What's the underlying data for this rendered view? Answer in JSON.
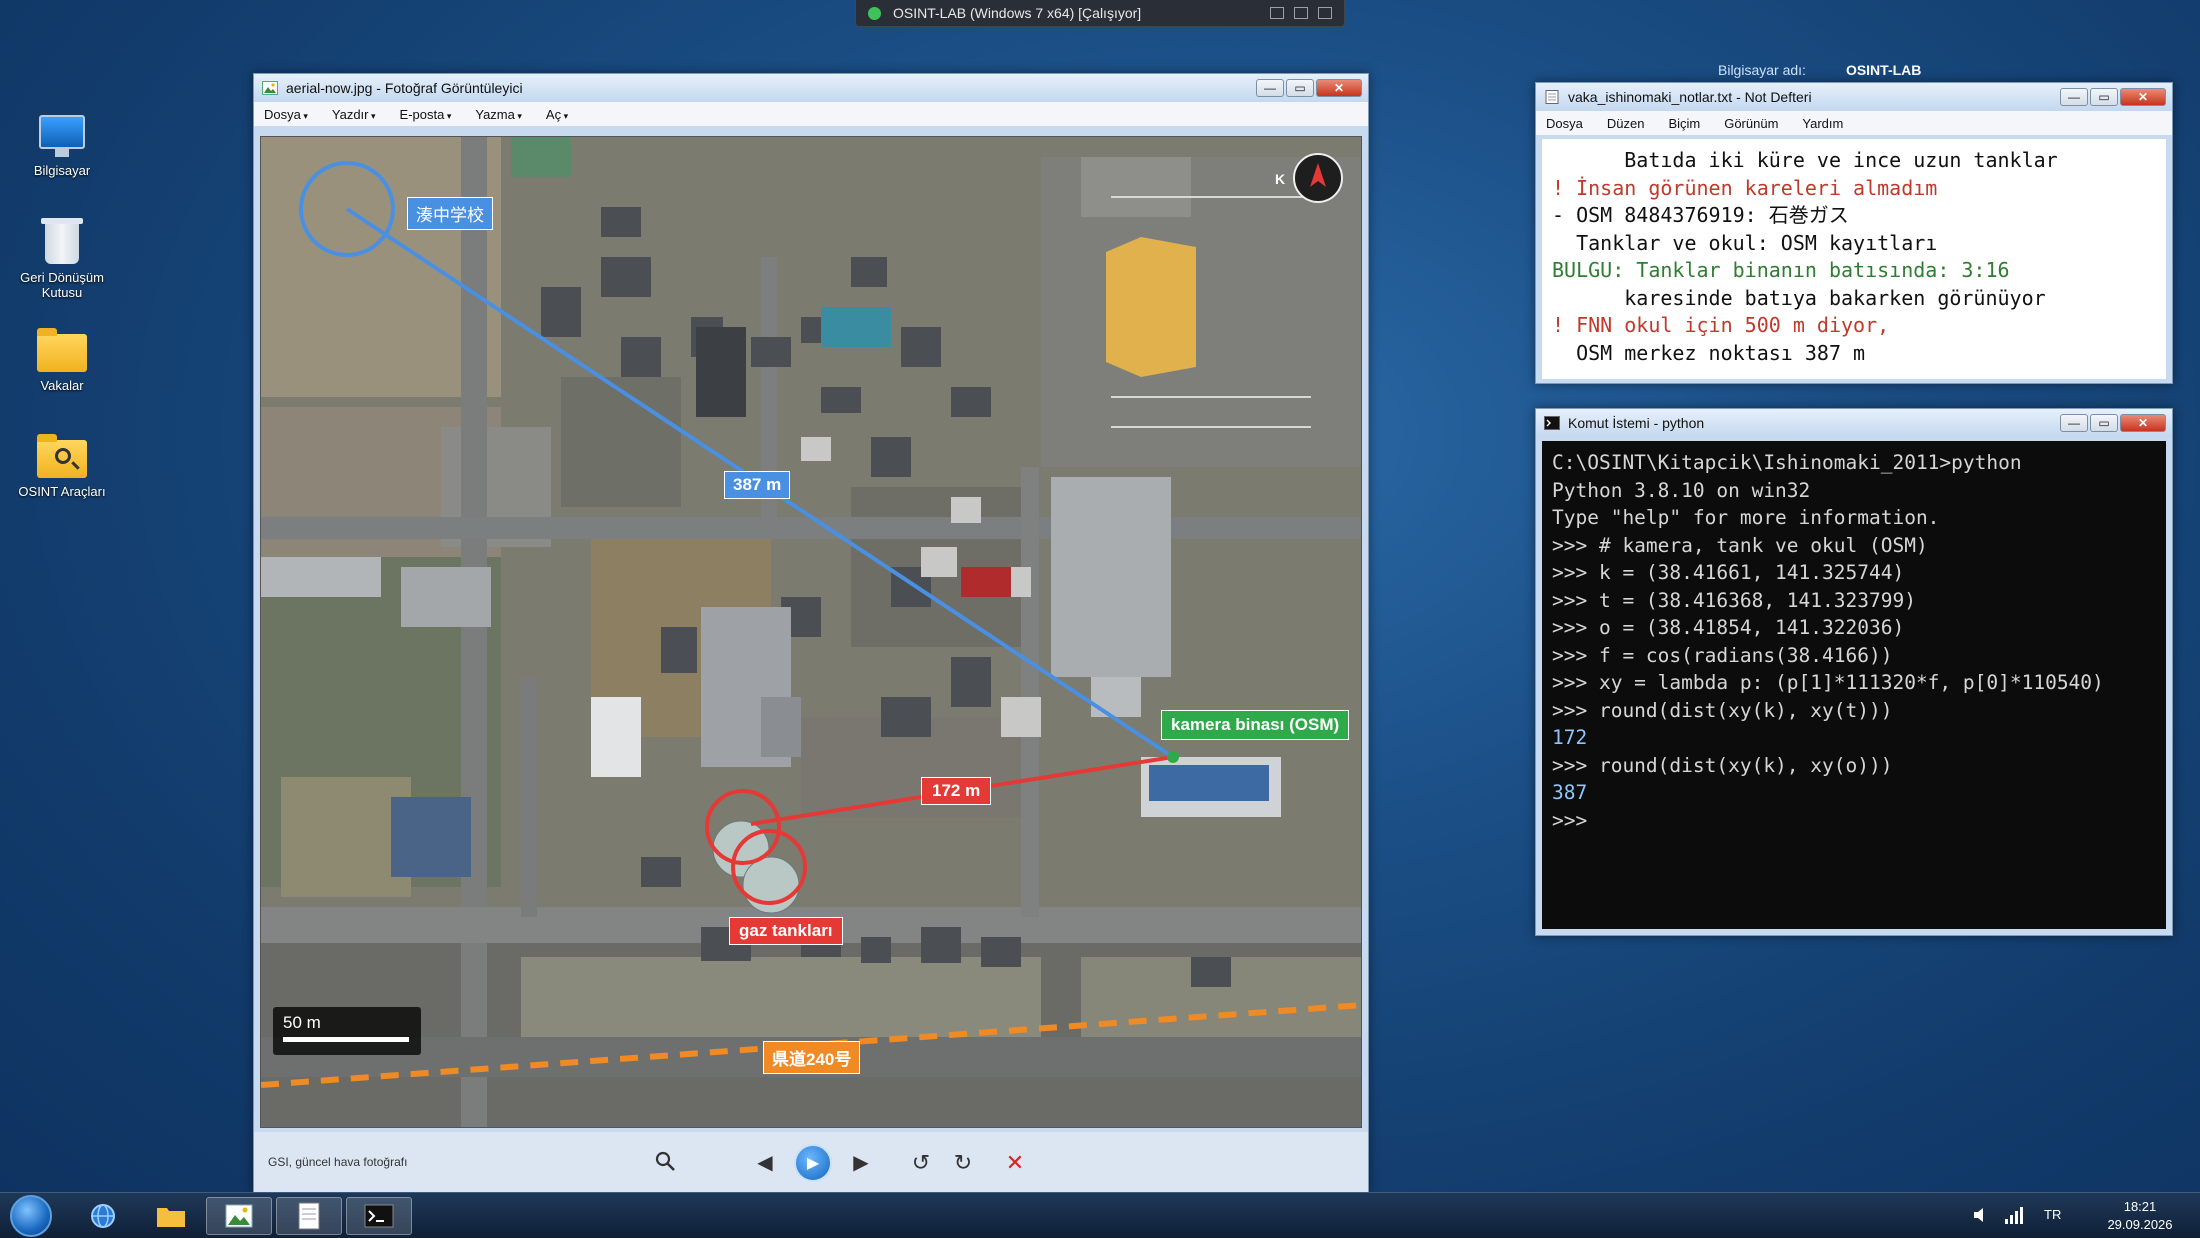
{
  "vm_bar": {
    "title": "OSINT-LAB (Windows 7 x64) [Çalışıyor]"
  },
  "desktop": {
    "icons": [
      {
        "label": "Bilgisayar",
        "icon": "computer-icon"
      },
      {
        "label": "Geri Dönüşüm Kutusu",
        "icon": "recycle-bin-icon"
      },
      {
        "label": "Vakalar",
        "icon": "folder-icon"
      },
      {
        "label": "OSINT Araçları",
        "icon": "folder-search-icon"
      }
    ],
    "computer_name_label": "Bilgisayar adı:",
    "computer_name": "OSINT-LAB"
  },
  "photo_viewer": {
    "title": "aerial-now.jpg - Fotoğraf Görüntüleyici",
    "menu": [
      "Dosya",
      "Yazdır",
      "E-posta",
      "Yazma",
      "Aç"
    ],
    "compass_label": "K",
    "overlays": {
      "school": "湊中学校",
      "dist_school": "387 m",
      "camera": "kamera binası (OSM)",
      "dist_tank": "172 m",
      "tanks": "gaz tankları",
      "road": "県道240号",
      "scale": "50 m"
    },
    "caption": "GSI, güncel hava fotoğrafı",
    "colors": {
      "blue_line": "#4a90e2",
      "red_line": "#e53935",
      "green_label": "#2eaa4a",
      "road": "#f08a24"
    }
  },
  "notepad": {
    "title": "vaka_ishinomaki_notlar.txt - Not Defteri",
    "menu": [
      "Dosya",
      "Düzen",
      "Biçim",
      "Görünüm",
      "Yardım"
    ],
    "lines": [
      "      Batıda iki küre ve ince uzun tanklar",
      "! İnsan görünen kareleri almadım",
      "- OSM 8484376919: 石巻ガス",
      "  Tanklar ve okul: OSM kayıtları",
      "BULGU: Tanklar binanın batısında: 3:16",
      "      karesinde batıya bakarken görünüyor",
      "! FNN okul için 500 m diyor,",
      "  OSM merkez noktası 387 m"
    ]
  },
  "cmd": {
    "title": "Komut İstemi - python",
    "lines": [
      "C:\\OSINT\\Kitapcik\\Ishinomaki_2011>python",
      "Python 3.8.10 on win32",
      "Type \"help\" for more information.",
      ">>> # kamera, tank ve okul (OSM)",
      ">>> k = (38.41661, 141.325744)",
      ">>> t = (38.416368, 141.323799)",
      ">>> o = (38.41854, 141.322036)",
      ">>> f = cos(radians(38.4166))",
      ">>> xy = lambda p: (p[1]*111320*f, p[0]*110540)",
      ">>> round(dist(xy(k), xy(t)))",
      "172",
      ">>> round(dist(xy(k), xy(o)))",
      "387",
      ">>> "
    ]
  },
  "taskbar": {
    "lang": "TR",
    "time": "18:21",
    "date": "29.09.2026"
  }
}
